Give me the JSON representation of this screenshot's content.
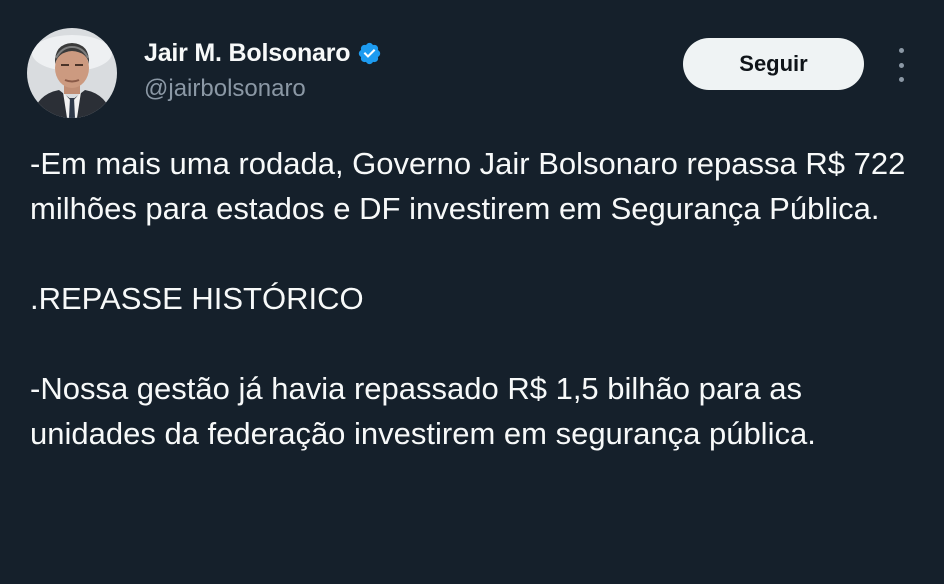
{
  "author": {
    "display_name": "Jair M. Bolsonaro",
    "handle": "@jairbolsonaro",
    "verified_icon": "verified-badge-icon",
    "avatar_icon": "avatar"
  },
  "actions": {
    "follow_label": "Seguir",
    "more_icon": "more-options-icon"
  },
  "tweet": {
    "paragraphs": [
      "-Em mais uma rodada, Governo Jair Bolsonaro repassa R$ 722 milhões para estados e DF investirem em Segurança Pública.",
      ".REPASSE HISTÓRICO",
      "-Nossa gestão já havia repassado R$ 1,5 bilhão para as unidades da federação investirem em segurança pública."
    ]
  },
  "colors": {
    "background": "#15202b",
    "text": "#f7f9f9",
    "secondary_text": "#8b98a5",
    "verified": "#1d9bf0",
    "follow_button_bg": "#eff3f4"
  }
}
